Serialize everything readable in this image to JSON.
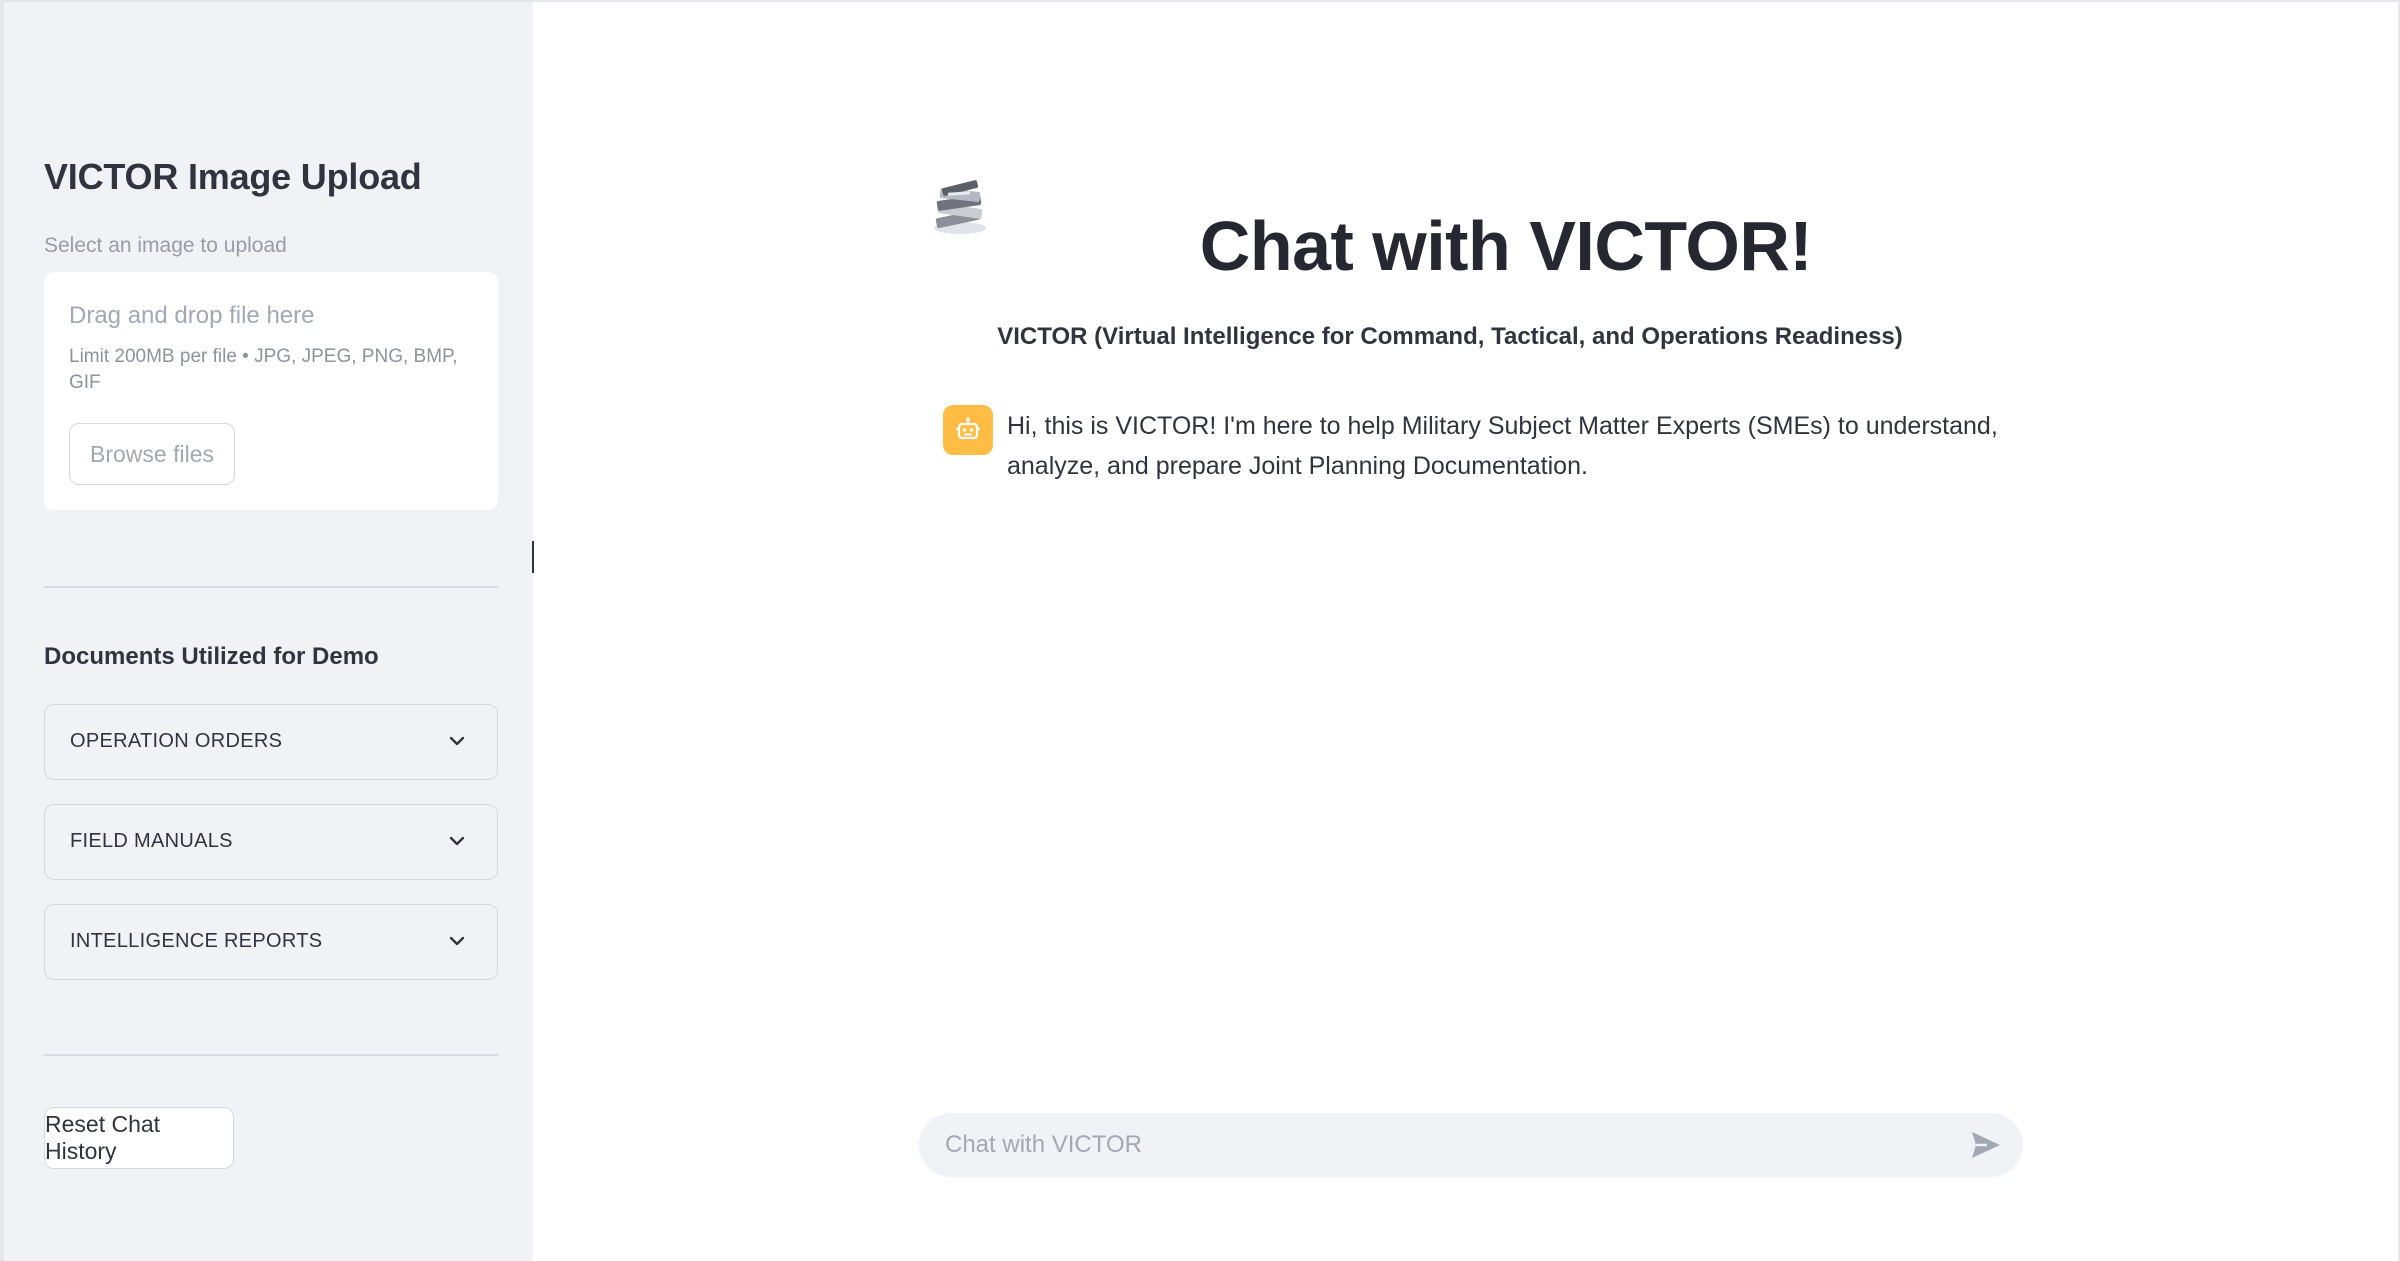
{
  "sidebar": {
    "title": "VICTOR Image Upload",
    "upload_label": "Select an image to upload",
    "dropzone": {
      "main_text": "Drag and drop file here",
      "hint": "Limit 200MB per file • JPG, JPEG, PNG, BMP, GIF",
      "browse_label": "Browse files"
    },
    "documents_heading": "Documents Utilized for Demo",
    "expanders": [
      {
        "label": "OPERATION ORDERS",
        "icon": "chevron-down-icon"
      },
      {
        "label": "FIELD MANUALS",
        "icon": "chevron-down-icon"
      },
      {
        "label": "INTELLIGENCE REPORTS",
        "icon": "chevron-down-icon"
      }
    ],
    "reset_label": "Reset Chat History"
  },
  "main": {
    "logo_icon": "document-stack-logo-icon",
    "title": "Chat with VICTOR!",
    "subtitle": "VICTOR (Virtual Intelligence for Command, Tactical, and Operations Readiness)",
    "messages": [
      {
        "role": "assistant",
        "avatar_icon": "robot-icon",
        "text": "Hi, this is VICTOR! I'm here to help Military Subject Matter Experts (SMEs) to understand, analyze, and prepare Joint Planning Documentation."
      }
    ],
    "chat_input": {
      "placeholder": "Chat with VICTOR",
      "value": "",
      "send_icon": "send-icon"
    }
  },
  "colors": {
    "sidebar_bg": "#f0f2f6",
    "text": "#31333f",
    "assistant_avatar": "#ffbd45",
    "muted_text": "#a3a8b4"
  }
}
